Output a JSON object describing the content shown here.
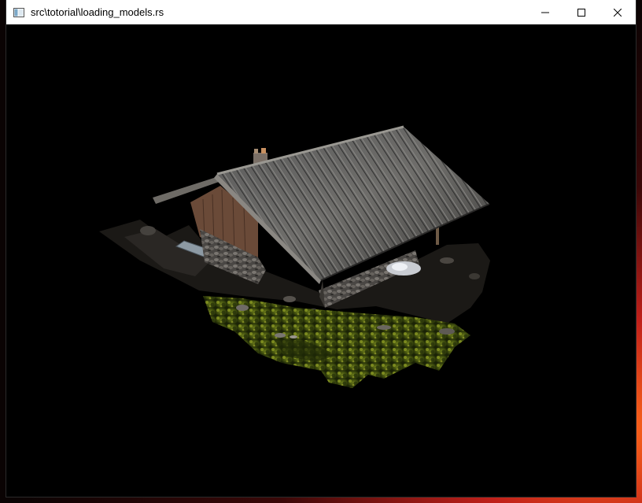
{
  "window": {
    "title": "src\\totorial\\loading_models.rs",
    "controls": {
      "minimize_icon": "minimize-icon",
      "maximize_icon": "maximize-icon",
      "close_icon": "close-icon"
    }
  },
  "scene": {
    "background_color": "#000000",
    "model": "stone hut with corrugated metal roof on grassy rock patch"
  },
  "desktop": {
    "accent": "#ff6a1a"
  }
}
